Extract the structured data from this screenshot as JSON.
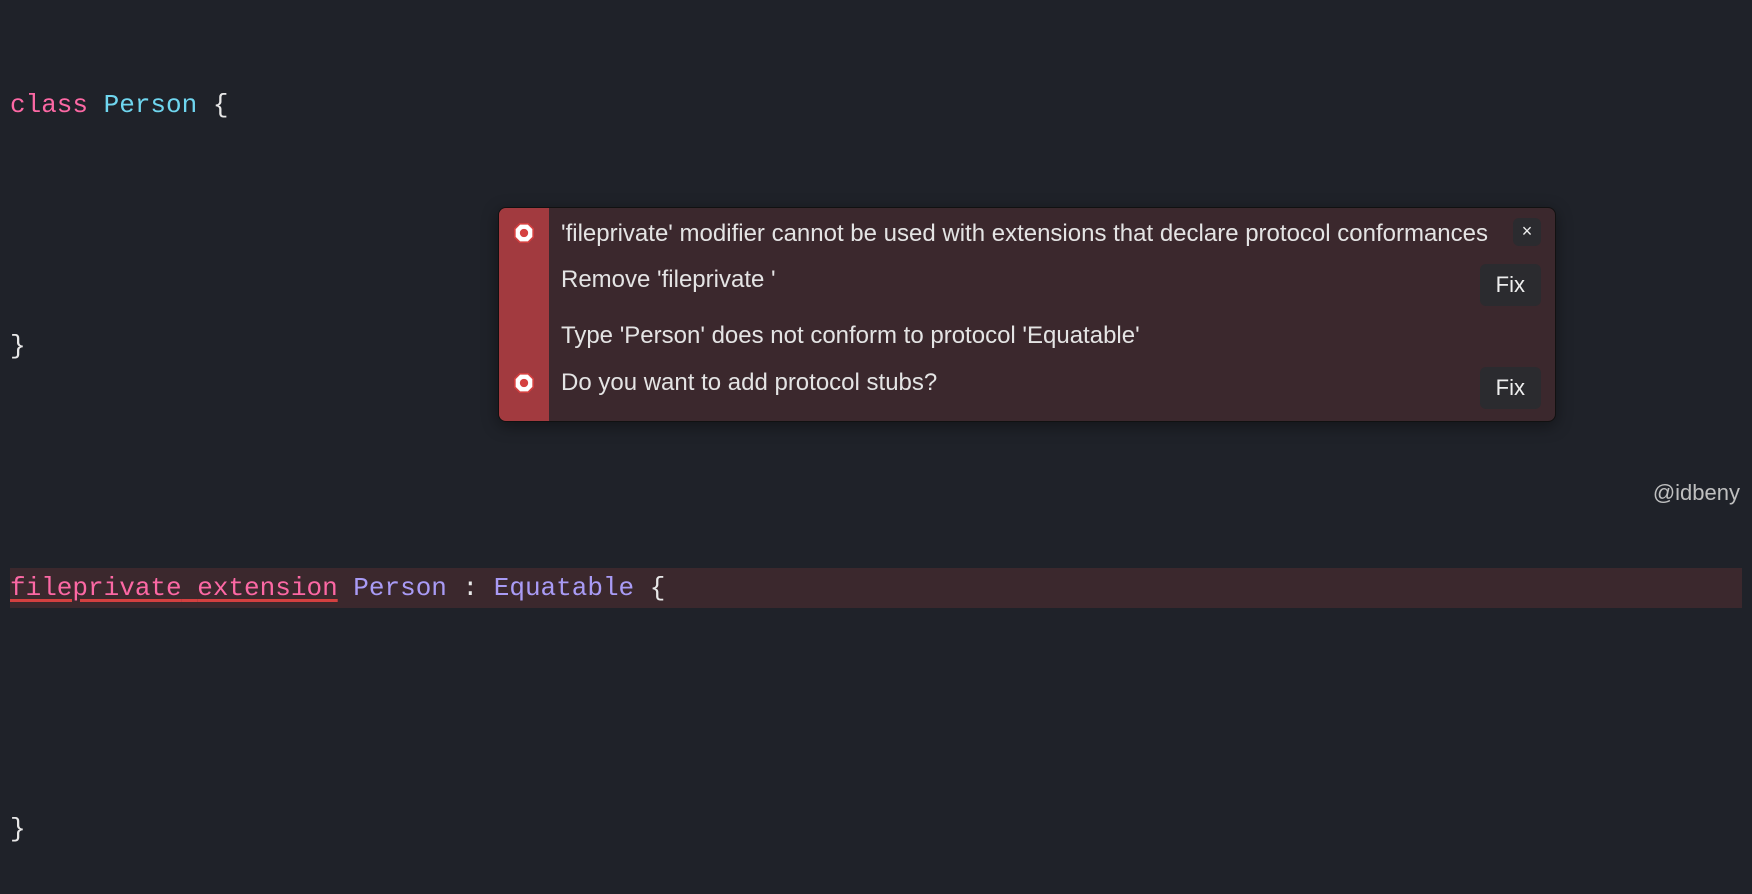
{
  "code": {
    "line1": {
      "kw": "class",
      "type": "Person",
      "brace_open": " {"
    },
    "line2": "",
    "line3": "}",
    "line4": "",
    "line5": {
      "kw1": "fileprivate",
      "space1": " ",
      "kw2": "extension",
      "space2": " ",
      "type": "Person",
      "sep": " : ",
      "proto": "Equatable",
      "brace_open": " {"
    },
    "line6": "",
    "line7": "}"
  },
  "popup": {
    "errors": [
      {
        "message": "'fileprivate' modifier cannot be used with extensions that declare protocol conformances",
        "fix_label": "Remove 'fileprivate '",
        "fix_button": "Fix"
      },
      {
        "message": "Type 'Person' does not conform to protocol 'Equatable'",
        "fix_label": "Do you want to add protocol stubs?",
        "fix_button": "Fix"
      }
    ],
    "close_icon": "×"
  },
  "watermark": "@idbeny"
}
